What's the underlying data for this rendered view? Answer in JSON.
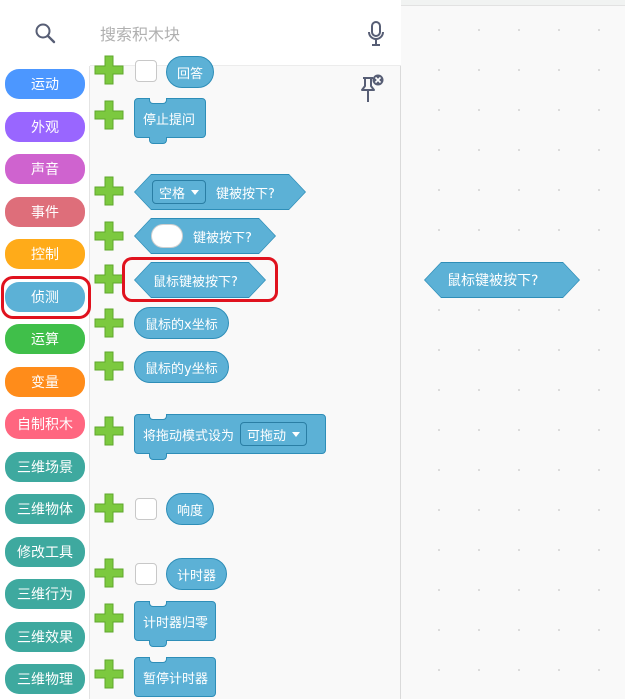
{
  "search": {
    "placeholder": "搜索积木块"
  },
  "categories": [
    {
      "label": "运动",
      "color": "#4c97ff"
    },
    {
      "label": "外观",
      "color": "#9966ff"
    },
    {
      "label": "声音",
      "color": "#cf63cf"
    },
    {
      "label": "事件",
      "color": "#de6e7a"
    },
    {
      "label": "控制",
      "color": "#ffab19"
    },
    {
      "label": "侦测",
      "color": "#5cb1d6"
    },
    {
      "label": "运算",
      "color": "#40bf4a"
    },
    {
      "label": "变量",
      "color": "#ff8c1a"
    },
    {
      "label": "自制积木",
      "color": "#ff6680"
    },
    {
      "label": "三维场景",
      "color": "#3ea99f"
    },
    {
      "label": "三维物体",
      "color": "#3ea99f"
    },
    {
      "label": "修改工具",
      "color": "#3ea99f"
    },
    {
      "label": "三维行为",
      "color": "#3ea99f"
    },
    {
      "label": "三维效果",
      "color": "#3ea99f"
    },
    {
      "label": "三维物理",
      "color": "#3ea99f"
    }
  ],
  "blocks": {
    "answer": "回答",
    "stop_asking": "停止提问",
    "space_dropdown": "空格",
    "key_pressed": "键被按下?",
    "key_pressed_2": "键被按下?",
    "mouse_down": "鼠标键被按下?",
    "mouse_x": "鼠标的x坐标",
    "mouse_y": "鼠标的y坐标",
    "set_drag_mode": "将拖动模式设为",
    "draggable": "可拖动",
    "loudness": "响度",
    "timer": "计时器",
    "reset_timer": "计时器归零",
    "pause_timer": "暂停计时器"
  },
  "workspace": {
    "block_label": "鼠标键被按下?"
  },
  "colors": {
    "sensing": "#5cb1d6",
    "sensing_border": "#2e8eb8",
    "highlight": "#e0121e",
    "plus": "#7cc93f"
  },
  "icons": [
    "search-icon",
    "microphone-icon",
    "pin-close-icon",
    "plus-icon"
  ]
}
